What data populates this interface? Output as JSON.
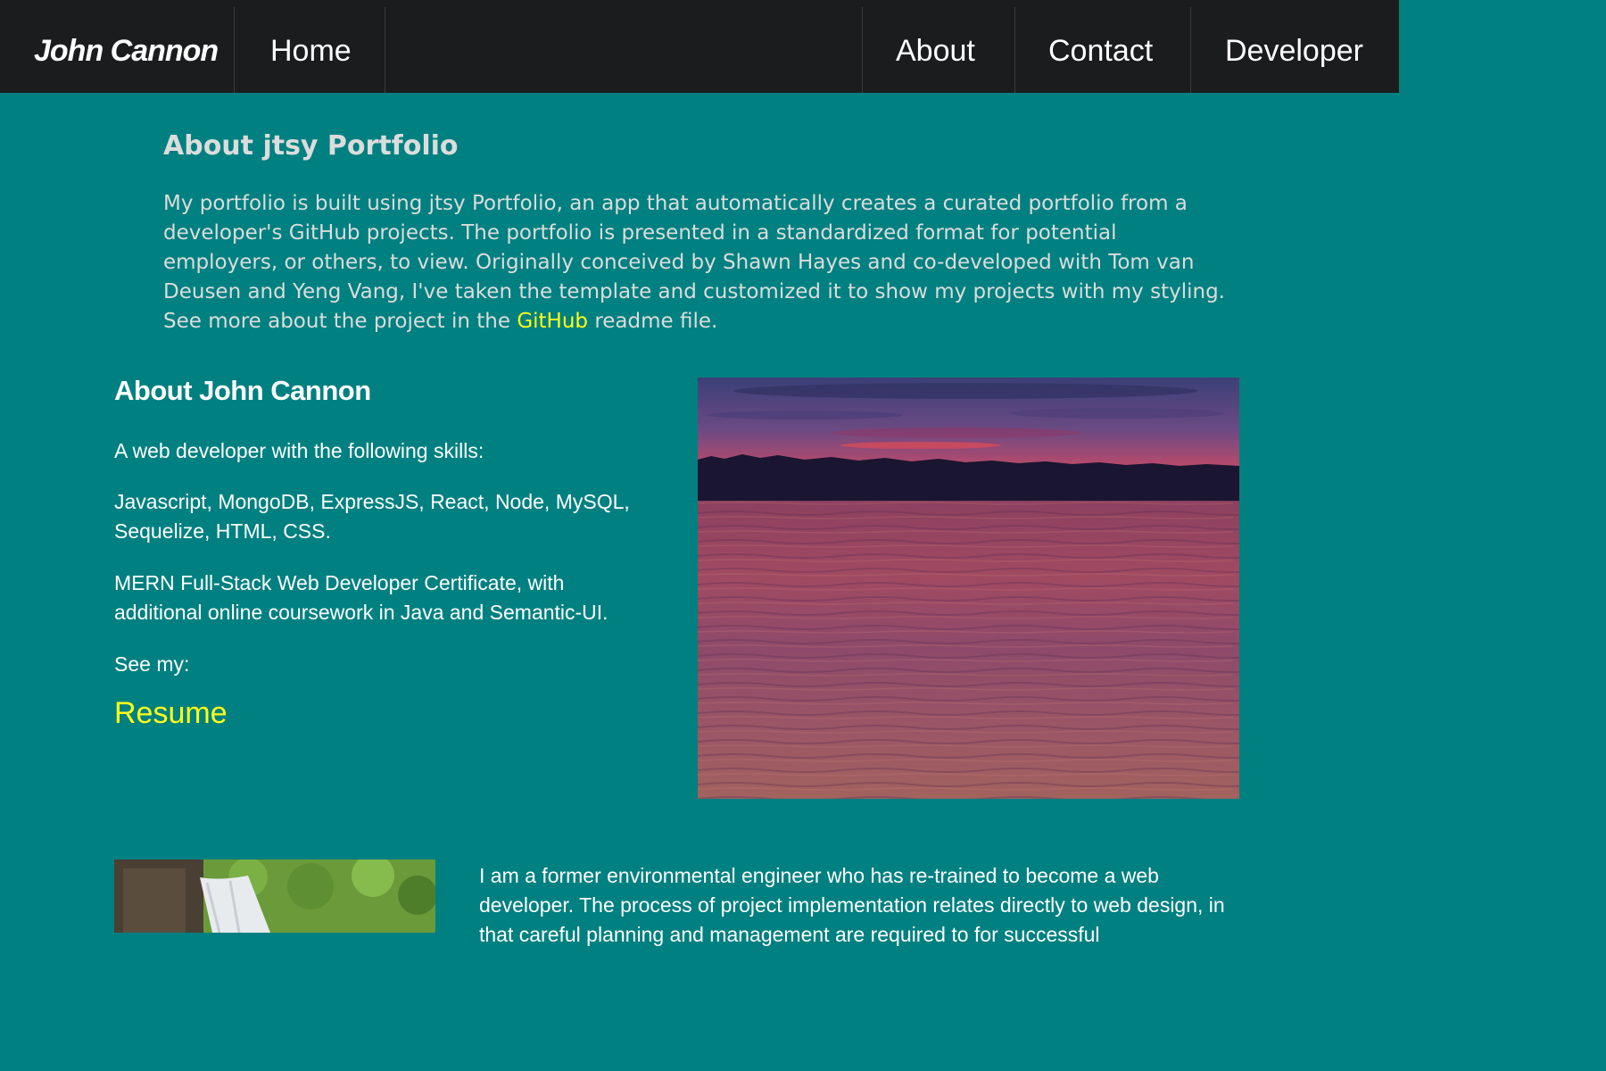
{
  "nav": {
    "brand": "John Cannon",
    "home": "Home",
    "about": "About",
    "contact": "Contact",
    "developer": "Developer"
  },
  "about_jtsy": {
    "title": "About jtsy Portfolio",
    "paragraph_before_link": "My portfolio is built using jtsy Portfolio, an app that automatically creates a curated portfolio from a developer's GitHub projects. The portfolio is presented in a standardized format for potential employers, or others, to view. Originally conceived by Shawn Hayes and co-developed with Tom van Deusen and Yeng Vang, I've taken the template and customized it to show my projects with my styling. See more about the project in the ",
    "link_text": "GitHub",
    "paragraph_after_link": " readme file."
  },
  "about_john": {
    "title": "About John Cannon",
    "intro": "A web developer with the following skills:",
    "skills": "Javascript, MongoDB, ExpressJS, React, Node, MySQL, Sequelize, HTML, CSS.",
    "certificate": "MERN Full-Stack Web Developer Certificate, with additional online coursework in Java and Semantic-UI.",
    "see_my": "See my:",
    "resume_link": "Resume"
  },
  "engineer_paragraph": "I am a former environmental engineer who has re-trained to become a web developer. The process of project implementation relates directly to web design, in that careful planning and management are required to for successful",
  "colors": {
    "background": "#008080",
    "nav_background": "#1b1c1d",
    "link": "#ffff1a"
  }
}
